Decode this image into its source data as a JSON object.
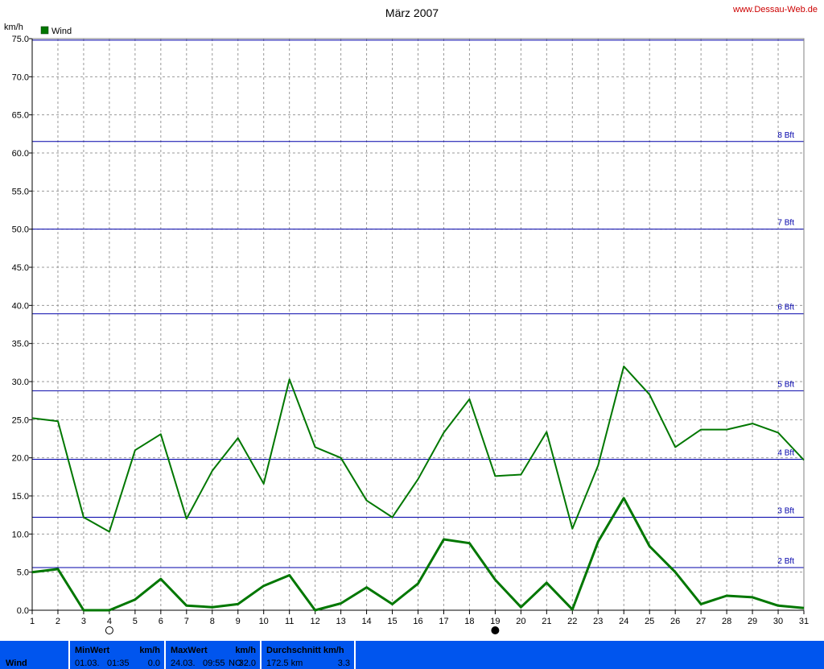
{
  "header": {
    "title": "März 2007",
    "source": "www.Dessau-Web.de",
    "legend_label": "Wind"
  },
  "chart_data": {
    "type": "line",
    "title": "März 2007",
    "ylabel": "km/h",
    "xlabel": "",
    "ylim": [
      0,
      75
    ],
    "y_ticks": [
      "0.0",
      "5.0",
      "10.0",
      "15.0",
      "20.0",
      "25.0",
      "30.0",
      "35.0",
      "40.0",
      "45.0",
      "50.0",
      "55.0",
      "60.0",
      "65.0",
      "70.0",
      "75.0"
    ],
    "x": [
      1,
      2,
      3,
      4,
      5,
      6,
      7,
      8,
      9,
      10,
      11,
      12,
      13,
      14,
      15,
      16,
      17,
      18,
      19,
      20,
      21,
      22,
      23,
      24,
      25,
      26,
      27,
      28,
      29,
      30,
      31
    ],
    "x_ticks": [
      "1",
      "2",
      "3",
      "4",
      "5",
      "6",
      "7",
      "8",
      "9",
      "10",
      "11",
      "12",
      "13",
      "14",
      "15",
      "16",
      "17",
      "18",
      "19",
      "20",
      "21",
      "22",
      "23",
      "24",
      "25",
      "26",
      "27",
      "28",
      "29",
      "30",
      "31"
    ],
    "grid": true,
    "legend": "top-left",
    "series": [
      {
        "name": "Wind",
        "color": "#007700",
        "values": [
          25.2,
          24.8,
          12.2,
          10.3,
          21.0,
          23.1,
          12.0,
          18.3,
          22.6,
          16.6,
          30.3,
          21.4,
          20.0,
          14.4,
          12.2,
          17.2,
          23.3,
          27.7,
          17.6,
          17.8,
          23.4,
          10.7,
          19.0,
          32.0,
          28.3,
          21.4,
          23.7,
          23.7,
          24.5,
          23.3,
          19.7
        ]
      },
      {
        "name": "",
        "color": "#007700",
        "values": [
          5.0,
          5.4,
          0.0,
          0.0,
          1.4,
          4.1,
          0.6,
          0.4,
          0.8,
          3.2,
          4.6,
          0.0,
          0.9,
          3.0,
          0.8,
          3.5,
          9.3,
          8.8,
          4.0,
          0.4,
          3.6,
          0.1,
          9.0,
          14.7,
          8.4,
          5.0,
          0.8,
          1.9,
          1.7,
          0.6,
          0.3
        ]
      }
    ],
    "beaufort_lines": [
      {
        "label": "2 Bft",
        "value": 5.6
      },
      {
        "label": "3 Bft",
        "value": 12.2
      },
      {
        "label": "4 Bft",
        "value": 19.8
      },
      {
        "label": "5 Bft",
        "value": 28.8
      },
      {
        "label": "6 Bft",
        "value": 38.9
      },
      {
        "label": "7 Bft",
        "value": 50.0
      },
      {
        "label": "8 Bft",
        "value": 61.5
      },
      {
        "label": "",
        "value": 74.8
      }
    ],
    "moon_phases": [
      {
        "day": 4,
        "phase": "full-moon"
      },
      {
        "day": 19,
        "phase": "new-moon"
      }
    ]
  },
  "footer": {
    "series_label": "Wind",
    "min": {
      "header": "MinWert",
      "unit": "km/h",
      "date": "01.03.",
      "time": "01:35",
      "value": "0.0"
    },
    "max": {
      "header": "MaxWert",
      "unit": "km/h",
      "date": "24.03.",
      "time": "09:55",
      "dir": "NO",
      "value": "32.0"
    },
    "avg": {
      "header": "Durchschnitt km/h",
      "distance": "172.5 km",
      "value": "3.3"
    }
  },
  "colors": {
    "series": "#007700",
    "reference_lines": "#0000aa",
    "grid": "#999999",
    "footer_bg": "#0055ee",
    "source_text": "#cc0000"
  }
}
